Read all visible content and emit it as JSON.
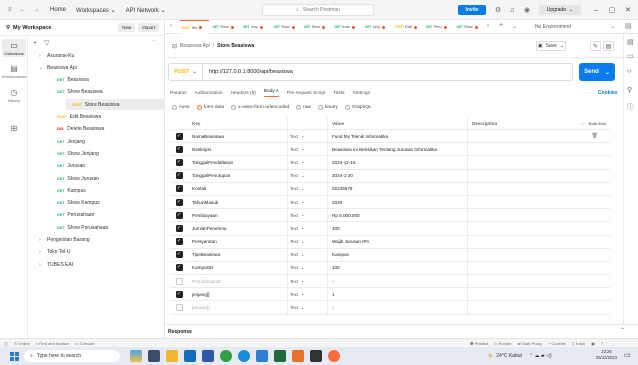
{
  "titlebar": {
    "menu": [
      "Home",
      "Workspaces",
      "API Network"
    ],
    "search_placeholder": "Search Postman",
    "invite": "Invite",
    "upgrade": "Upgrade"
  },
  "sidebar": {
    "workspace": "My Workspace",
    "new_label": "New",
    "import_label": "Import",
    "rail": [
      "Collections",
      "Environments",
      "History"
    ],
    "tree": [
      {
        "label": "Asuransi-Ku",
        "kind": "folder",
        "open": false
      },
      {
        "label": "Beasiswa Api",
        "kind": "folder",
        "open": true
      },
      {
        "label": "Beasiswa",
        "kind": "req",
        "method": "GET"
      },
      {
        "label": "Show Beasiswa",
        "kind": "req",
        "method": "GET"
      },
      {
        "label": "Store Beasiswa",
        "kind": "req",
        "method": "POST",
        "selected": true
      },
      {
        "label": "Edit Beasiswa",
        "kind": "req",
        "method": "POST"
      },
      {
        "label": "Delete Beasiswa",
        "kind": "req",
        "method": "DEL"
      },
      {
        "label": "Jenjang",
        "kind": "req",
        "method": "GET"
      },
      {
        "label": "Show Jenjang",
        "kind": "req",
        "method": "GET"
      },
      {
        "label": "Jurusan",
        "kind": "req",
        "method": "GET"
      },
      {
        "label": "Show Jurusan",
        "kind": "req",
        "method": "GET"
      },
      {
        "label": "Kampus",
        "kind": "req",
        "method": "GET"
      },
      {
        "label": "Show Kampus",
        "kind": "req",
        "method": "GET"
      },
      {
        "label": "Perusahaan",
        "kind": "req",
        "method": "GET"
      },
      {
        "label": "Show Perusahaan",
        "kind": "req",
        "method": "GET"
      },
      {
        "label": "Pengelolan Barang",
        "kind": "folder",
        "open": false
      },
      {
        "label": "Toko Tel-U",
        "kind": "folder",
        "open": false
      },
      {
        "label": "TUBES EAI",
        "kind": "folder",
        "open": false
      }
    ]
  },
  "tabs": {
    "items": [
      {
        "method": "POST",
        "label": "Sto"
      },
      {
        "method": "GET",
        "label": "Shov"
      },
      {
        "method": "GET",
        "label": "Juru"
      },
      {
        "method": "GET",
        "label": "Shov"
      },
      {
        "method": "GET",
        "label": "Shov"
      },
      {
        "method": "GET",
        "label": "Kam"
      },
      {
        "method": "GET",
        "label": "Jenj"
      },
      {
        "method": "POST",
        "label": "Edit"
      },
      {
        "method": "GET",
        "label": "Peru"
      },
      {
        "method": "GET",
        "label": "Shov"
      }
    ],
    "env": "No Environment"
  },
  "breadcrumb": {
    "collection": "Beasiswa Api",
    "separator": "/",
    "request": "Store Beasiswa",
    "save": "Save"
  },
  "request": {
    "method": "POST",
    "url": "http://127.0.0.1:8000/api/beasiswa",
    "send": "Send",
    "tabs": [
      "Params",
      "Authorization",
      "Headers (8)",
      "Body",
      "Pre-request Script",
      "Tests",
      "Settings"
    ],
    "active_tab": "Body",
    "cookies": "Cookies",
    "body_types": [
      "none",
      "form-data",
      "x-www-form-urlencoded",
      "raw",
      "binary",
      "GraphQL"
    ],
    "active_body_type": "form-data"
  },
  "table": {
    "headers": {
      "key": "Key",
      "value": "Value",
      "description": "Description",
      "bulk": "Bulk Edit"
    },
    "rows": [
      {
        "key": "NamaBeasiswa",
        "type": "Text",
        "value": "Fund My Teknik Informatika",
        "checked": true
      },
      {
        "key": "Deskripsi",
        "type": "Text",
        "value": "Beasiswa Ini Berisikan Tentang Jurusan Informatika",
        "checked": true
      },
      {
        "key": "TanggalPendaftaran",
        "type": "Text",
        "value": "2023-12-15",
        "checked": true
      },
      {
        "key": "TanggalPenutupan",
        "type": "Text",
        "value": "2024-1-30",
        "checked": true
      },
      {
        "key": "Kontak",
        "type": "Text",
        "value": "02245678",
        "checked": true
      },
      {
        "key": "TahunMasuk",
        "type": "Text",
        "value": "2020",
        "checked": true
      },
      {
        "key": "Pembiayaan",
        "type": "Text",
        "value": "Rp 5.000.000",
        "checked": true
      },
      {
        "key": "JumlahPenerima",
        "type": "Text",
        "value": "100",
        "checked": true
      },
      {
        "key": "Persyaratan",
        "type": "Text",
        "value": "Wajib Jurusan IPA",
        "checked": true
      },
      {
        "key": "TipeBeasiswa",
        "type": "Text",
        "value": "Kampus",
        "checked": true
      },
      {
        "key": "KampusID",
        "type": "Text",
        "value": "100",
        "checked": true
      },
      {
        "key": "PerusahaanID",
        "type": "Text",
        "value": "1",
        "checked": false
      },
      {
        "key": "jenjang[]",
        "type": "Text",
        "value": "1",
        "checked": true
      },
      {
        "key": "jurusan[]",
        "type": "Text",
        "value": "1",
        "checked": false
      }
    ]
  },
  "response": {
    "label": "Response"
  },
  "statusbar": {
    "left": [
      "Online",
      "Find and replace",
      "Console"
    ],
    "right": [
      "Postbot",
      "Runner",
      "Start Proxy",
      "Cookies",
      "Trash"
    ]
  },
  "taskbar": {
    "search_placeholder": "Type here to search",
    "weather": "24°C  Kabut",
    "time": "23:26",
    "date": "25/12/2023"
  }
}
